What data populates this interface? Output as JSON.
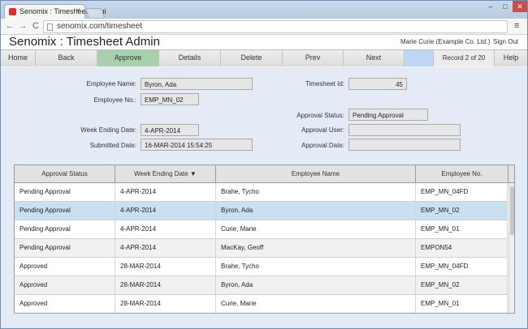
{
  "browser": {
    "tab_title": "Senomix : Timesheet Admi",
    "tab_close": "×",
    "url": "senomix.com/timesheet",
    "win_min": "–",
    "win_max": "□",
    "win_close": "✕",
    "back": "←",
    "forward": "→",
    "reload": "C",
    "menu": "≡"
  },
  "header": {
    "title": "Senomix : Timesheet Admin",
    "user": "Marie Curie  (Example Co. Ltd.)",
    "signout": "Sign Out"
  },
  "toolbar": {
    "home": "Home",
    "back": "Back",
    "approve": "Approve",
    "details": "Details",
    "delete": "Delete",
    "prev": "Prev",
    "next": "Next",
    "record": "Record 2 of 20",
    "help": "Help"
  },
  "form": {
    "employee_name_label": "Employee Name:",
    "employee_name": "Byron, Ada",
    "employee_no_label": "Employee No.:",
    "employee_no": "EMP_MN_02",
    "week_ending_label": "Week Ending Date:",
    "week_ending": "4-APR-2014",
    "submitted_label": "Submitted Date:",
    "submitted": "16-MAR-2014 15:54:25",
    "timesheet_id_label": "Timesheet Id:",
    "timesheet_id": "45",
    "approval_status_label": "Approval Status:",
    "approval_status": "Pending Approval",
    "approval_user_label": "Approval User:",
    "approval_user": "",
    "approval_date_label": "Approval Date:",
    "approval_date": ""
  },
  "grid": {
    "columns": [
      "Approval Status",
      "Week Ending Date ▼",
      "Employee Name",
      "Employee No."
    ],
    "rows": [
      [
        "Pending Approval",
        "4-APR-2014",
        "Brahe, Tycho",
        "EMP_MN_04FD"
      ],
      [
        "Pending Approval",
        "4-APR-2014",
        "Byron, Ada",
        "EMP_MN_02"
      ],
      [
        "Pending Approval",
        "4-APR-2014",
        "Curie, Marie",
        "EMP_MN_01"
      ],
      [
        "Pending Approval",
        "4-APR-2014",
        "MacKay, Geoff",
        "EMPON54"
      ],
      [
        "Approved",
        "28-MAR-2014",
        "Brahe, Tycho",
        "EMP_MN_04FD"
      ],
      [
        "Approved",
        "28-MAR-2014",
        "Byron, Ada",
        "EMP_MN_02"
      ],
      [
        "Approved",
        "28-MAR-2014",
        "Curie, Marie",
        "EMP_MN_01"
      ]
    ]
  },
  "colors": {
    "approve_active": "#a9d0ad",
    "selected_row": "#c9e0f0",
    "form_background": "#e4ebf7"
  }
}
